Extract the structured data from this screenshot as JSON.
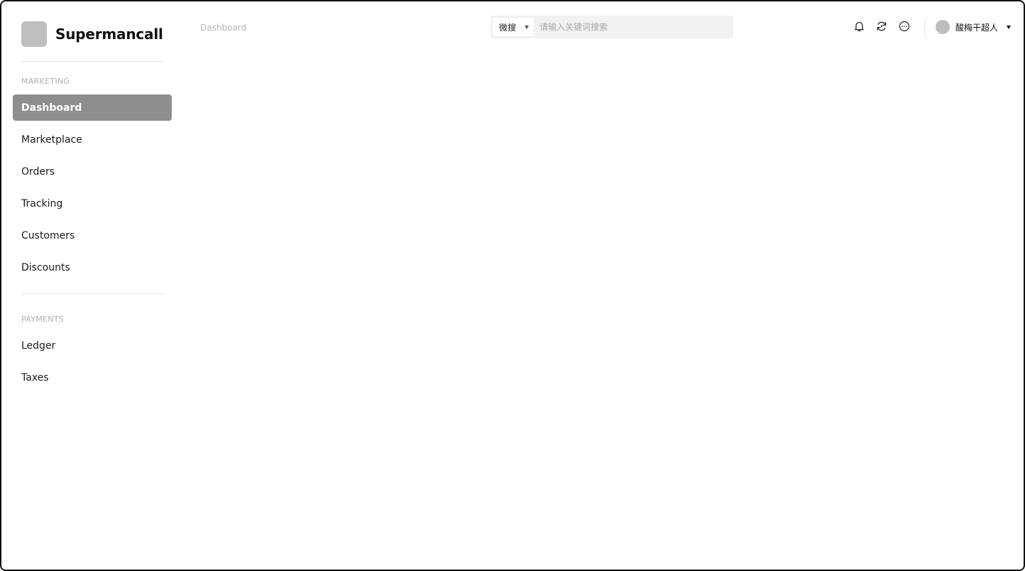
{
  "brand": {
    "name": "Supermancall"
  },
  "sidebar": {
    "sections": [
      {
        "title": "MARKETING",
        "items": [
          {
            "label": "Dashboard",
            "active": true
          },
          {
            "label": "Marketplace"
          },
          {
            "label": "Orders"
          },
          {
            "label": "Tracking"
          },
          {
            "label": "Customers"
          },
          {
            "label": "Discounts"
          }
        ]
      },
      {
        "title": "PAYMENTS",
        "items": [
          {
            "label": "Ledger"
          },
          {
            "label": "Taxes"
          }
        ]
      }
    ]
  },
  "header": {
    "breadcrumb": "Dashboard",
    "search": {
      "scope_selected": "微搜",
      "placeholder": "请输入关键词搜索"
    },
    "icons": [
      "bell-icon",
      "refresh-icon",
      "more-icon"
    ],
    "user": {
      "name": "酸梅干超人"
    }
  },
  "colors": {
    "active_nav_bg": "#8e8e8e",
    "section_title": "#b0b0b0",
    "search_bg": "#f1f1f1",
    "avatar": "#bdbdbd"
  }
}
